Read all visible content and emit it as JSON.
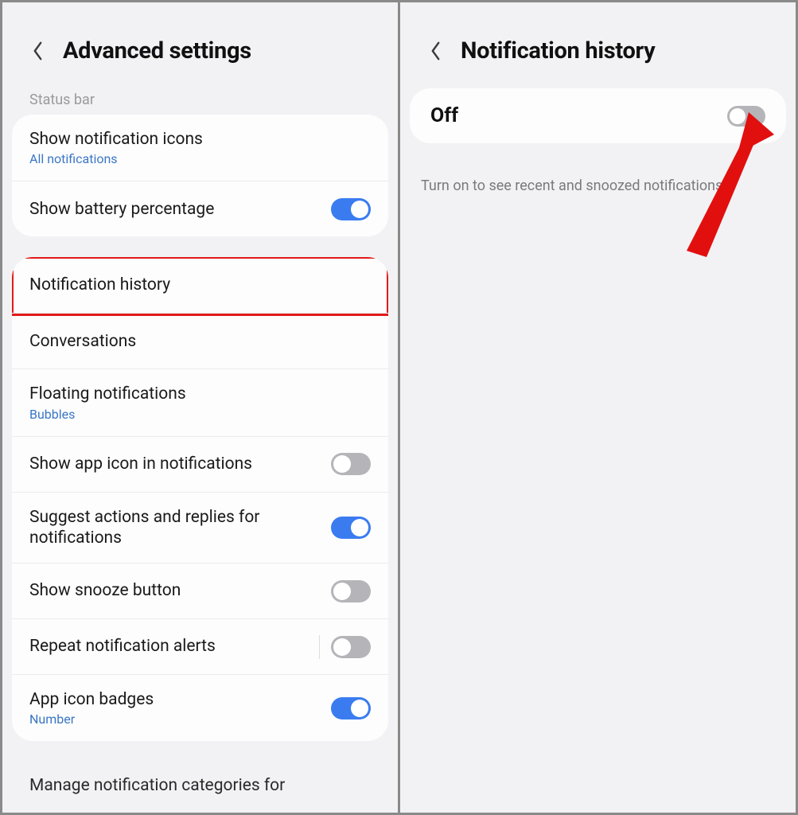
{
  "left": {
    "title": "Advanced settings",
    "section_statusbar": "Status bar",
    "items": {
      "show_icons": {
        "title": "Show notification icons",
        "sub": "All notifications"
      },
      "battery": {
        "title": "Show battery percentage"
      },
      "history": {
        "title": "Notification history"
      },
      "conversations": {
        "title": "Conversations"
      },
      "floating": {
        "title": "Floating notifications",
        "sub": "Bubbles"
      },
      "app_icon": {
        "title": "Show app icon in notifications"
      },
      "suggest": {
        "title": "Suggest actions and replies for notifications"
      },
      "snooze": {
        "title": "Show snooze button"
      },
      "repeat": {
        "title": "Repeat notification alerts"
      },
      "badges": {
        "title": "App icon badges",
        "sub": "Number"
      },
      "cutoff": "Manage notification categories for"
    }
  },
  "right": {
    "title": "Notification history",
    "state": "Off",
    "hint": "Turn on to see recent and snoozed notifications."
  }
}
